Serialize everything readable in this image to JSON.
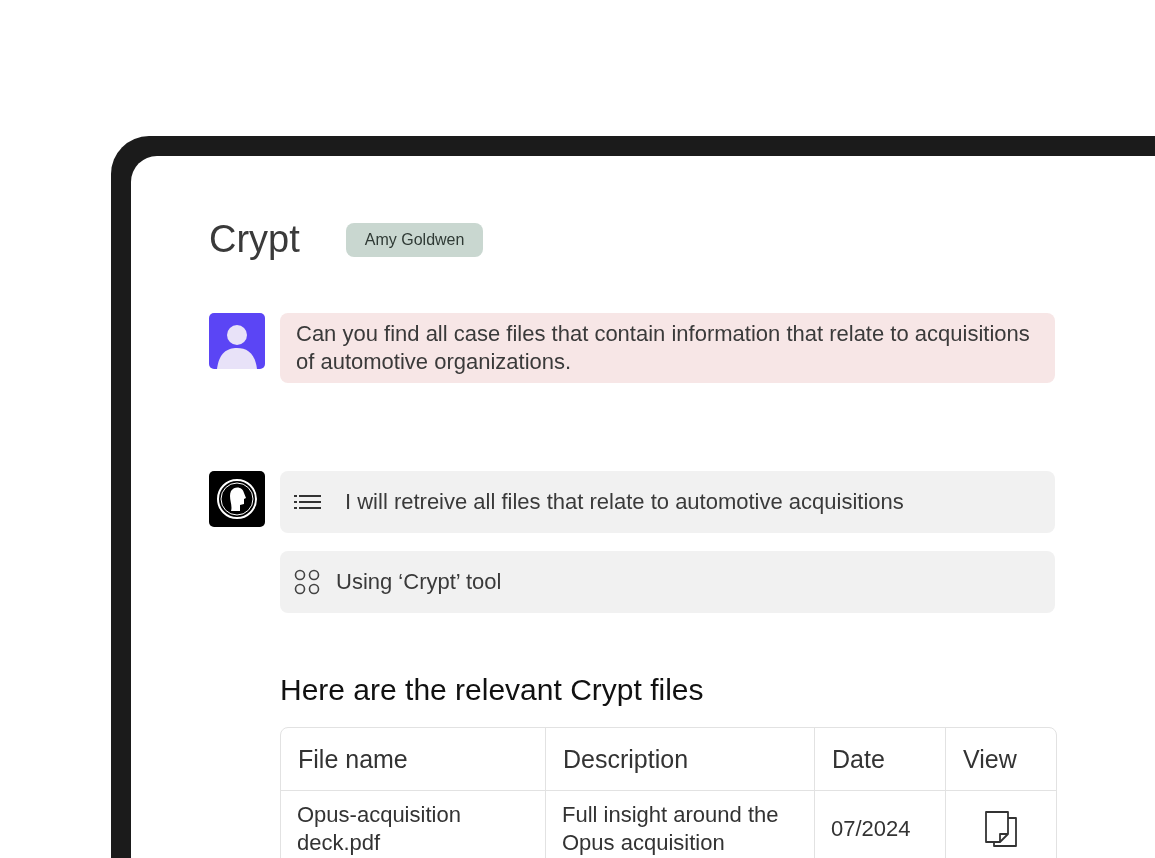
{
  "header": {
    "title": "Crypt",
    "user_badge": "Amy Goldwen"
  },
  "user_message": {
    "text": "Can you find all case files that contain information that relate to acquisitions of automotive organizations."
  },
  "assistant_steps": [
    {
      "kind": "plan",
      "text": "I will retreive all files that relate to automotive acquisitions"
    },
    {
      "kind": "tool",
      "text": "Using ‘Crypt’ tool"
    }
  ],
  "results": {
    "heading": "Here are the relevant Crypt files",
    "table": {
      "columns": [
        "File name",
        "Description",
        "Date",
        "View"
      ],
      "rows": [
        {
          "file_name": "Opus-acquisition deck.pdf",
          "description": "Full insight around the Opus acquisition",
          "date": "07/2024"
        }
      ]
    }
  }
}
